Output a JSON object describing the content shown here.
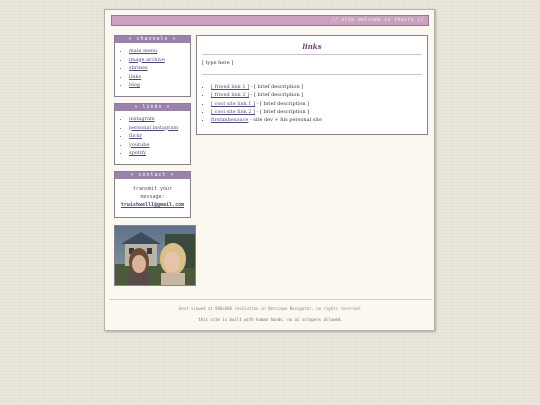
{
  "banner": {
    "text": "// site welcome is theirs //"
  },
  "channels": {
    "title": "» channels «",
    "items": [
      "main menu",
      "image archive",
      "shrines",
      "links",
      "blog"
    ]
  },
  "links_box": {
    "title": "» links «",
    "items": [
      "instagram",
      "personal instagram",
      "flickr",
      "youtube",
      "spotify"
    ]
  },
  "contact": {
    "title": "» contact «",
    "line1": "transmit your",
    "line2": "message:",
    "email": "trwishwell1@gmail.com"
  },
  "main": {
    "title": "links",
    "typehere": "[ type here ]",
    "entries": [
      {
        "link": "[ friend link 1 ]",
        "desc": " - [ brief description ]"
      },
      {
        "link": "[ friend link 2 ]",
        "desc": " - [ brief description ]"
      },
      {
        "link": "[ cool site link 1 ]",
        "desc": " - [ brief description ]"
      },
      {
        "link": "[ cool site link 2 ]",
        "desc": " - [ brief description ]"
      },
      {
        "link": "firstimhesauce",
        "desc": " - site dev + his personal site"
      }
    ]
  },
  "footer": {
    "line1": "best viewed at 800x600 resolution in Netscape Navigator. no rights reserved.",
    "line2": "this site is built with human hands. no ai scrapers allowed."
  },
  "colors": {
    "accent": "#9a82ad",
    "banner": "#c9a3bd",
    "title": "#6b3f74"
  }
}
